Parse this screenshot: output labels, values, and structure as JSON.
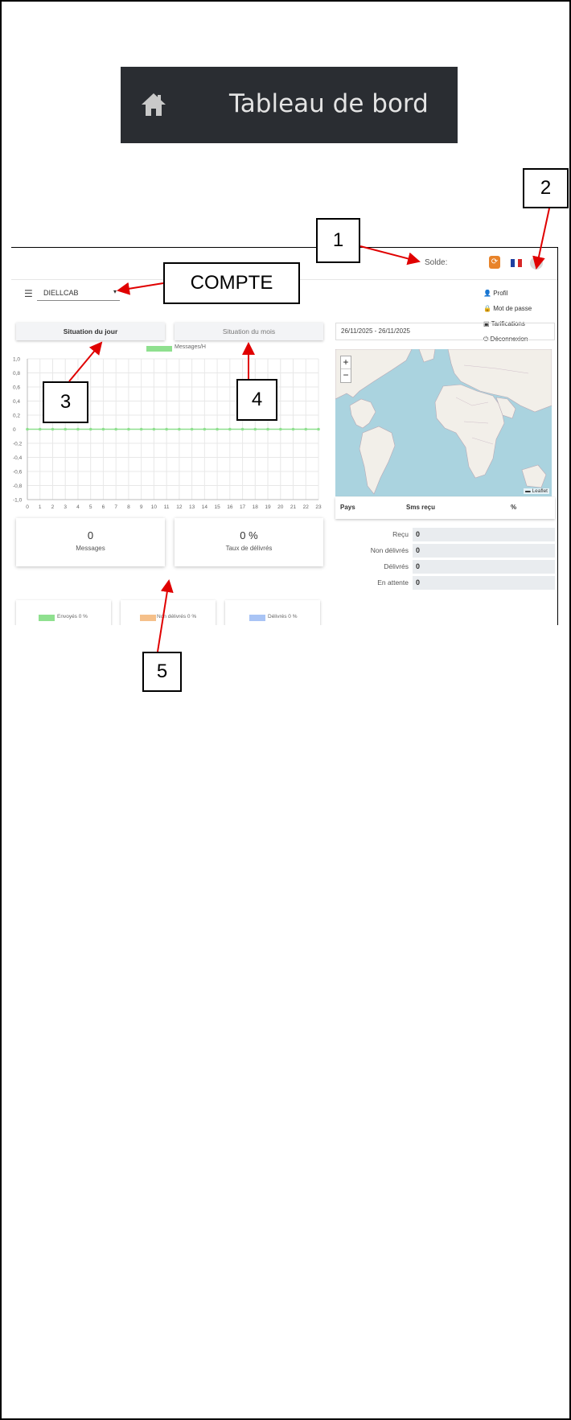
{
  "banner": {
    "icon": "home-icon",
    "title": "Tableau de bord"
  },
  "header": {
    "balance_label": "Solde:",
    "refresh_icon": "refresh-icon",
    "flag_icon": "french-flag-icon",
    "user_icon": "user-icon"
  },
  "account": {
    "menu_icon": "hamburger-icon",
    "selected": "DIELLCAB"
  },
  "user_menu": {
    "items": [
      {
        "icon": "user-icon",
        "label": "Profil"
      },
      {
        "icon": "lock-icon",
        "label": "Mot de passe"
      },
      {
        "icon": "pricing-icon",
        "label": "Tarifications"
      },
      {
        "icon": "power-icon",
        "label": "Déconnexion"
      }
    ]
  },
  "tabs": {
    "day": "Situation du jour",
    "month": "Situation du mois"
  },
  "chart_data": {
    "type": "line",
    "x": [
      0,
      1,
      2,
      3,
      4,
      5,
      6,
      7,
      8,
      9,
      10,
      11,
      12,
      13,
      14,
      15,
      16,
      17,
      18,
      19,
      20,
      21,
      22,
      23
    ],
    "series": [
      {
        "name": "Messages/H",
        "values": [
          0,
          0,
          0,
          0,
          0,
          0,
          0,
          0,
          0,
          0,
          0,
          0,
          0,
          0,
          0,
          0,
          0,
          0,
          0,
          0,
          0,
          0,
          0,
          0
        ],
        "color": "#8fe08f"
      }
    ],
    "yticks": [
      "1,0",
      "0,8",
      "0,6",
      "0,4",
      "0,2",
      "0",
      "-0,2",
      "-0,4",
      "-0,6",
      "-0,8",
      "-1,0"
    ],
    "ylim": [
      -1,
      1
    ],
    "xlim": [
      0,
      23
    ],
    "grid": true,
    "legend": "top-center"
  },
  "stats": {
    "messages_value": "0",
    "messages_label": "Messages",
    "rate_value": "0 %",
    "rate_label": "Taux de délivrés"
  },
  "mini_legend": [
    {
      "label": "Envoyés 0 %",
      "color": "#8fe08f"
    },
    {
      "label": "Non délivrés 0 %",
      "color": "#f5c08a"
    },
    {
      "label": "Délivrés 0 %",
      "color": "#a9c4f5"
    }
  ],
  "date_range": "26/11/2025 - 26/11/2025",
  "map": {
    "zoom_in": "+",
    "zoom_out": "−",
    "attribution": "Leaflet"
  },
  "country_table": {
    "headers": [
      "Pays",
      "Sms reçu",
      "%"
    ]
  },
  "summary": [
    {
      "label": "Reçu",
      "value": "0"
    },
    {
      "label": "Non délivrés",
      "value": "0"
    },
    {
      "label": "Délivrés",
      "value": "0"
    },
    {
      "label": "En attente",
      "value": "0"
    }
  ],
  "callouts": {
    "c1": "1",
    "c2": "2",
    "c3": "3",
    "c4": "4",
    "c5": "5",
    "compte": "COMPTE"
  },
  "colors": {
    "banner_bg": "#2a2d32",
    "accent_orange": "#e8832a",
    "arrow_red": "#e00000",
    "map_water": "#aad3df",
    "map_land": "#f2efe9"
  }
}
